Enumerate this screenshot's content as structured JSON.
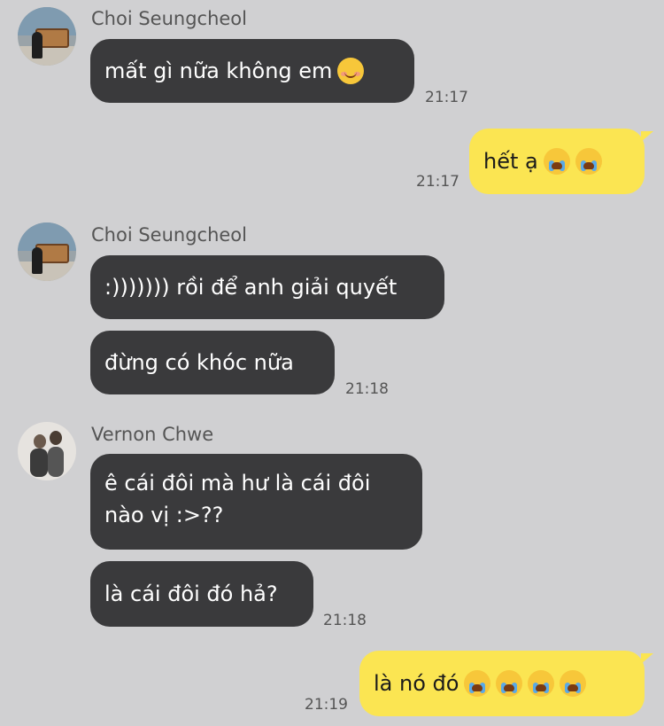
{
  "messages": {
    "m1": {
      "sender": "Choi Seungcheol",
      "text": "mất gì nữa không em",
      "emoji": "smiling-face-icon",
      "time": "21:17"
    },
    "m2": {
      "text": "hết ạ",
      "emoji": [
        "crying-face-icon",
        "crying-face-icon"
      ],
      "time": "21:17"
    },
    "m3": {
      "sender": "Choi Seungcheol",
      "text1": ":))))))) rồi để anh giải quyết",
      "text2": "đừng có khóc nữa",
      "time": "21:18"
    },
    "m4": {
      "sender": "Vernon Chwe",
      "text1_line1": "ê cái đôi mà hư là cái đôi",
      "text1_line2": "nào vị :>??",
      "text2": "là cái đôi đó hả?",
      "time": "21:18"
    },
    "m5": {
      "text": "là nó đó",
      "emoji": [
        "crying-face-icon",
        "crying-face-icon",
        "crying-face-icon",
        "crying-face-icon"
      ],
      "time": "21:19"
    }
  },
  "colors": {
    "background": "#d0d0d2",
    "incoming_bubble": "#3a3a3c",
    "outgoing_bubble": "#fbe552"
  }
}
